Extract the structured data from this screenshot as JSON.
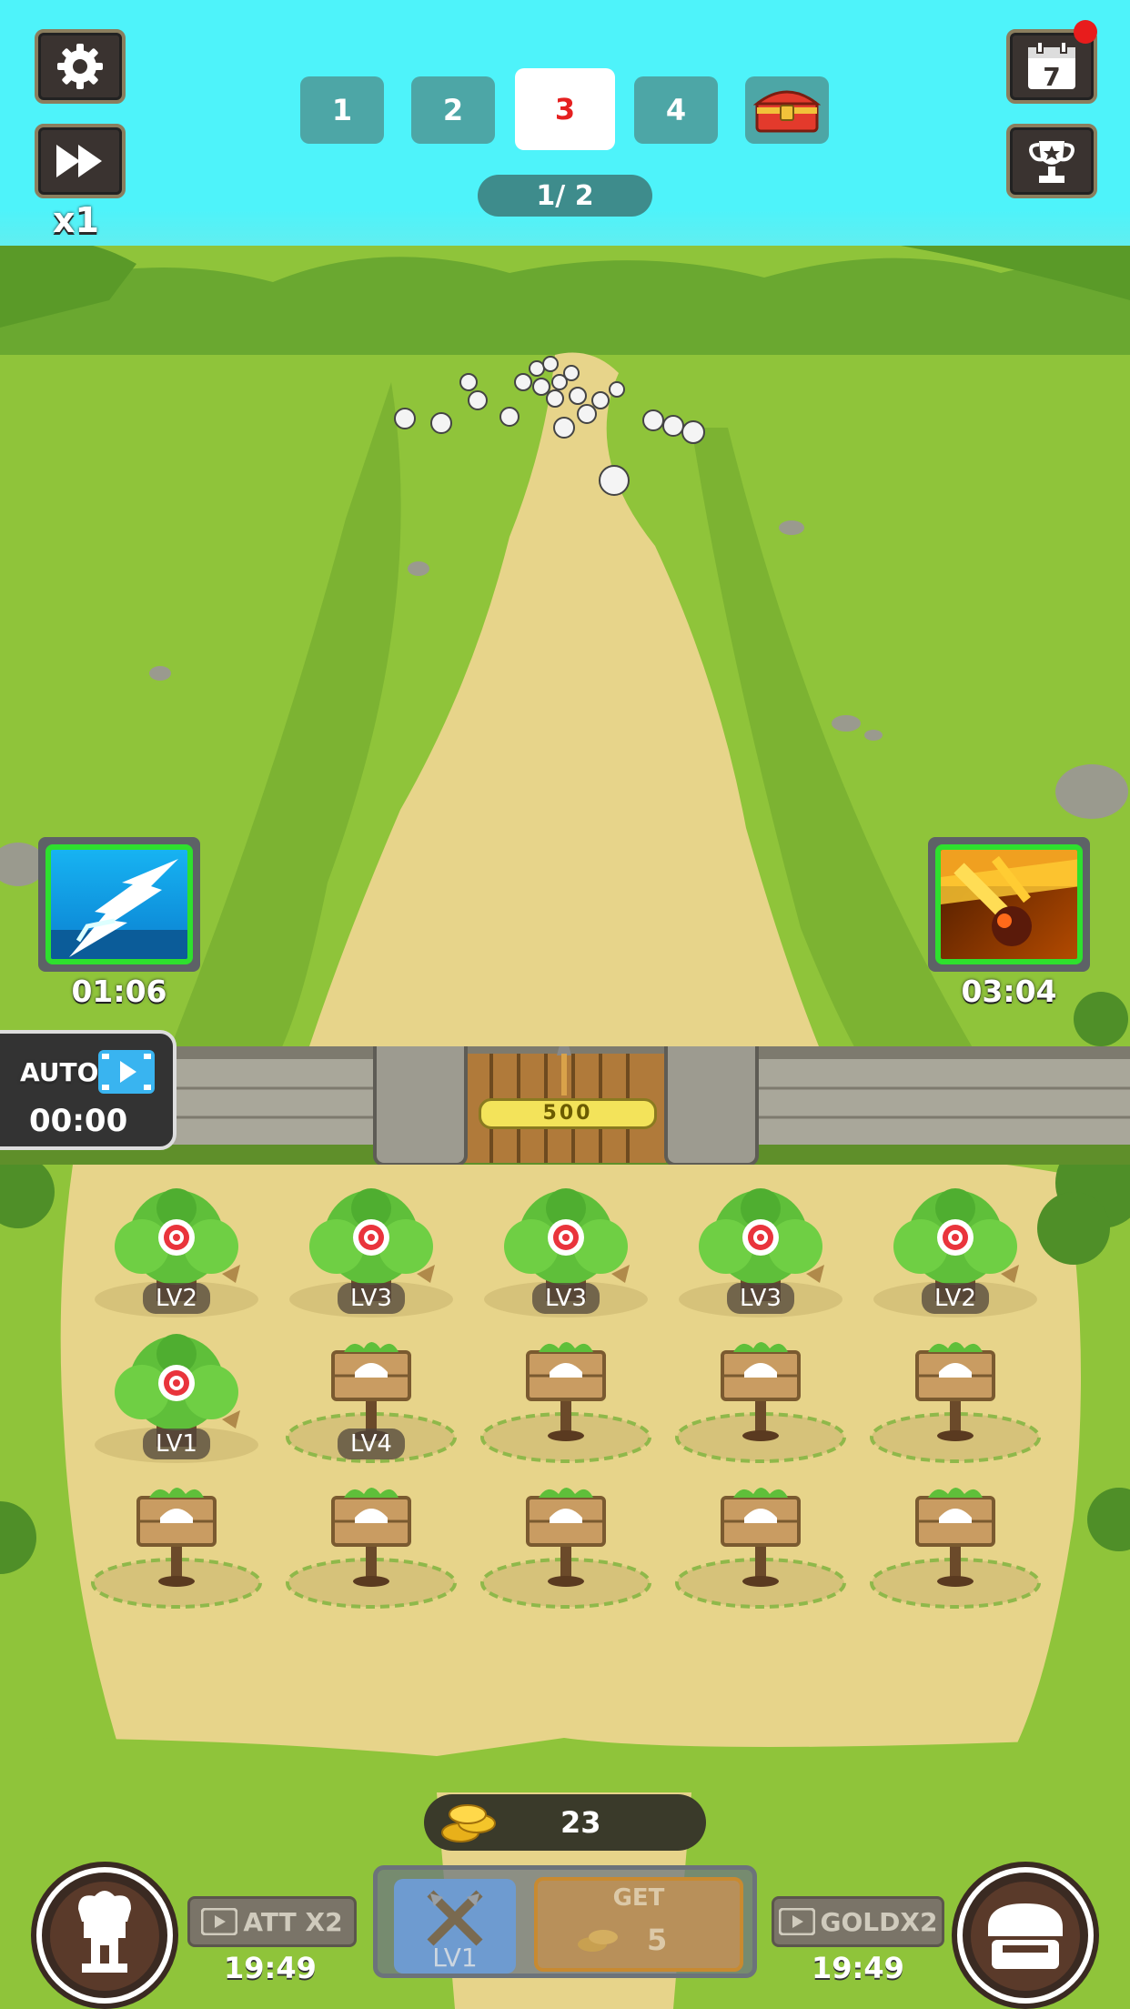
{
  "top_bar": {
    "speed_label": "x1",
    "waves": [
      {
        "label": "1",
        "active": false
      },
      {
        "label": "2",
        "active": false
      },
      {
        "label": "3",
        "active": true
      },
      {
        "label": "4",
        "active": false
      }
    ],
    "wave_progress": "1/ 2",
    "calendar_day": "7"
  },
  "skills": {
    "lightning_timer": "01:06",
    "meteor_timer": "03:04"
  },
  "auto": {
    "label": "AUTO",
    "timer": "00:00"
  },
  "gate": {
    "hp": "500"
  },
  "towers": [
    {
      "type": "archer",
      "level": "LV2"
    },
    {
      "type": "archer",
      "level": "LV3"
    },
    {
      "type": "archer",
      "level": "LV3"
    },
    {
      "type": "archer",
      "level": "LV3"
    },
    {
      "type": "archer",
      "level": "LV2"
    },
    {
      "type": "archer",
      "level": "LV1"
    },
    {
      "type": "empty",
      "level": "LV4"
    },
    {
      "type": "empty",
      "level": ""
    },
    {
      "type": "empty",
      "level": ""
    },
    {
      "type": "empty",
      "level": ""
    },
    {
      "type": "empty",
      "level": ""
    },
    {
      "type": "empty",
      "level": ""
    },
    {
      "type": "empty",
      "level": ""
    },
    {
      "type": "empty",
      "level": ""
    },
    {
      "type": "empty",
      "level": ""
    }
  ],
  "bottom": {
    "coins": "23",
    "att_label": "ATT X2",
    "att_timer": "19:49",
    "upgrade_level": "LV1",
    "get_label": "GET",
    "get_amount": "5",
    "gold_label": "GOLDX2",
    "gold_timer": "19:49"
  },
  "colors": {
    "sky": "#4ef3fa",
    "grass": "#8fc43a",
    "path": "#e7d48a",
    "tab": "#4da6a6",
    "active_tab_text": "#e52020",
    "skill_border": "#2ee02e"
  }
}
